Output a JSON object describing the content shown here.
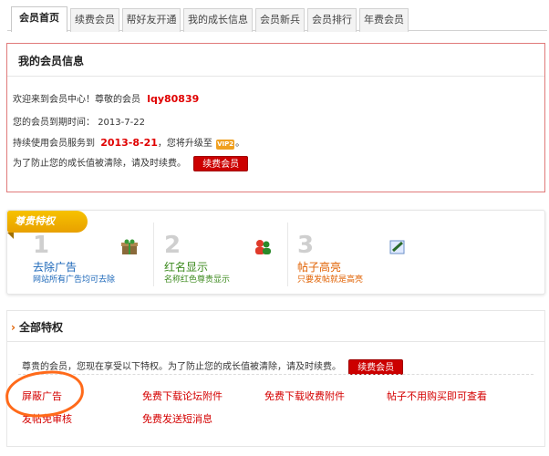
{
  "tabs": [
    {
      "label": "会员首页",
      "active": true
    },
    {
      "label": "续费会员"
    },
    {
      "label": "帮好友开通"
    },
    {
      "label": "我的成长信息"
    },
    {
      "label": "会员新兵"
    },
    {
      "label": "会员排行"
    },
    {
      "label": "年费会员"
    }
  ],
  "member_info": {
    "title": "我的会员信息",
    "welcome_prefix": "欢迎来到会员中心！尊敬的会员",
    "username": "lqy80839",
    "expire_label": "您的会员到期时间：",
    "expire_date": "2013-7-22",
    "continue_prefix": "持续使用会员服务到",
    "continue_date": "2013-8-21",
    "continue_suffix": "，您将升级至",
    "vip_badge": "VIP2",
    "renew_notice": "为了防止您的成长值被清除，请及时续费。",
    "renew_button": "续费会员"
  },
  "privileges": {
    "ribbon": "尊贵特权",
    "items": [
      {
        "num": "1",
        "name": "去除广告",
        "desc": "网站所有广告均可去除",
        "color": "#1a66b8"
      },
      {
        "num": "2",
        "name": "红名显示",
        "desc": "名称红色尊贵显示",
        "color": "#3c8a1e"
      },
      {
        "num": "3",
        "name": "帖子高亮",
        "desc": "只要发帖就是高亮",
        "color": "#e06000"
      }
    ]
  },
  "all_features": {
    "title": "全部特权",
    "notice": "尊贵的会员，您现在享受以下特权。为了防止您的成长值被清除，请及时续费。",
    "renew_button": "续费会员",
    "items": [
      "屏蔽广告",
      "免费下载论坛附件",
      "免费下载收费附件",
      "帖子不用购买即可查看",
      "发帖免审核",
      "免费发送短消息"
    ]
  },
  "colors": {
    "accent": "#cc0000",
    "border": "#e07a7a",
    "ribbon": "#f0b400"
  }
}
